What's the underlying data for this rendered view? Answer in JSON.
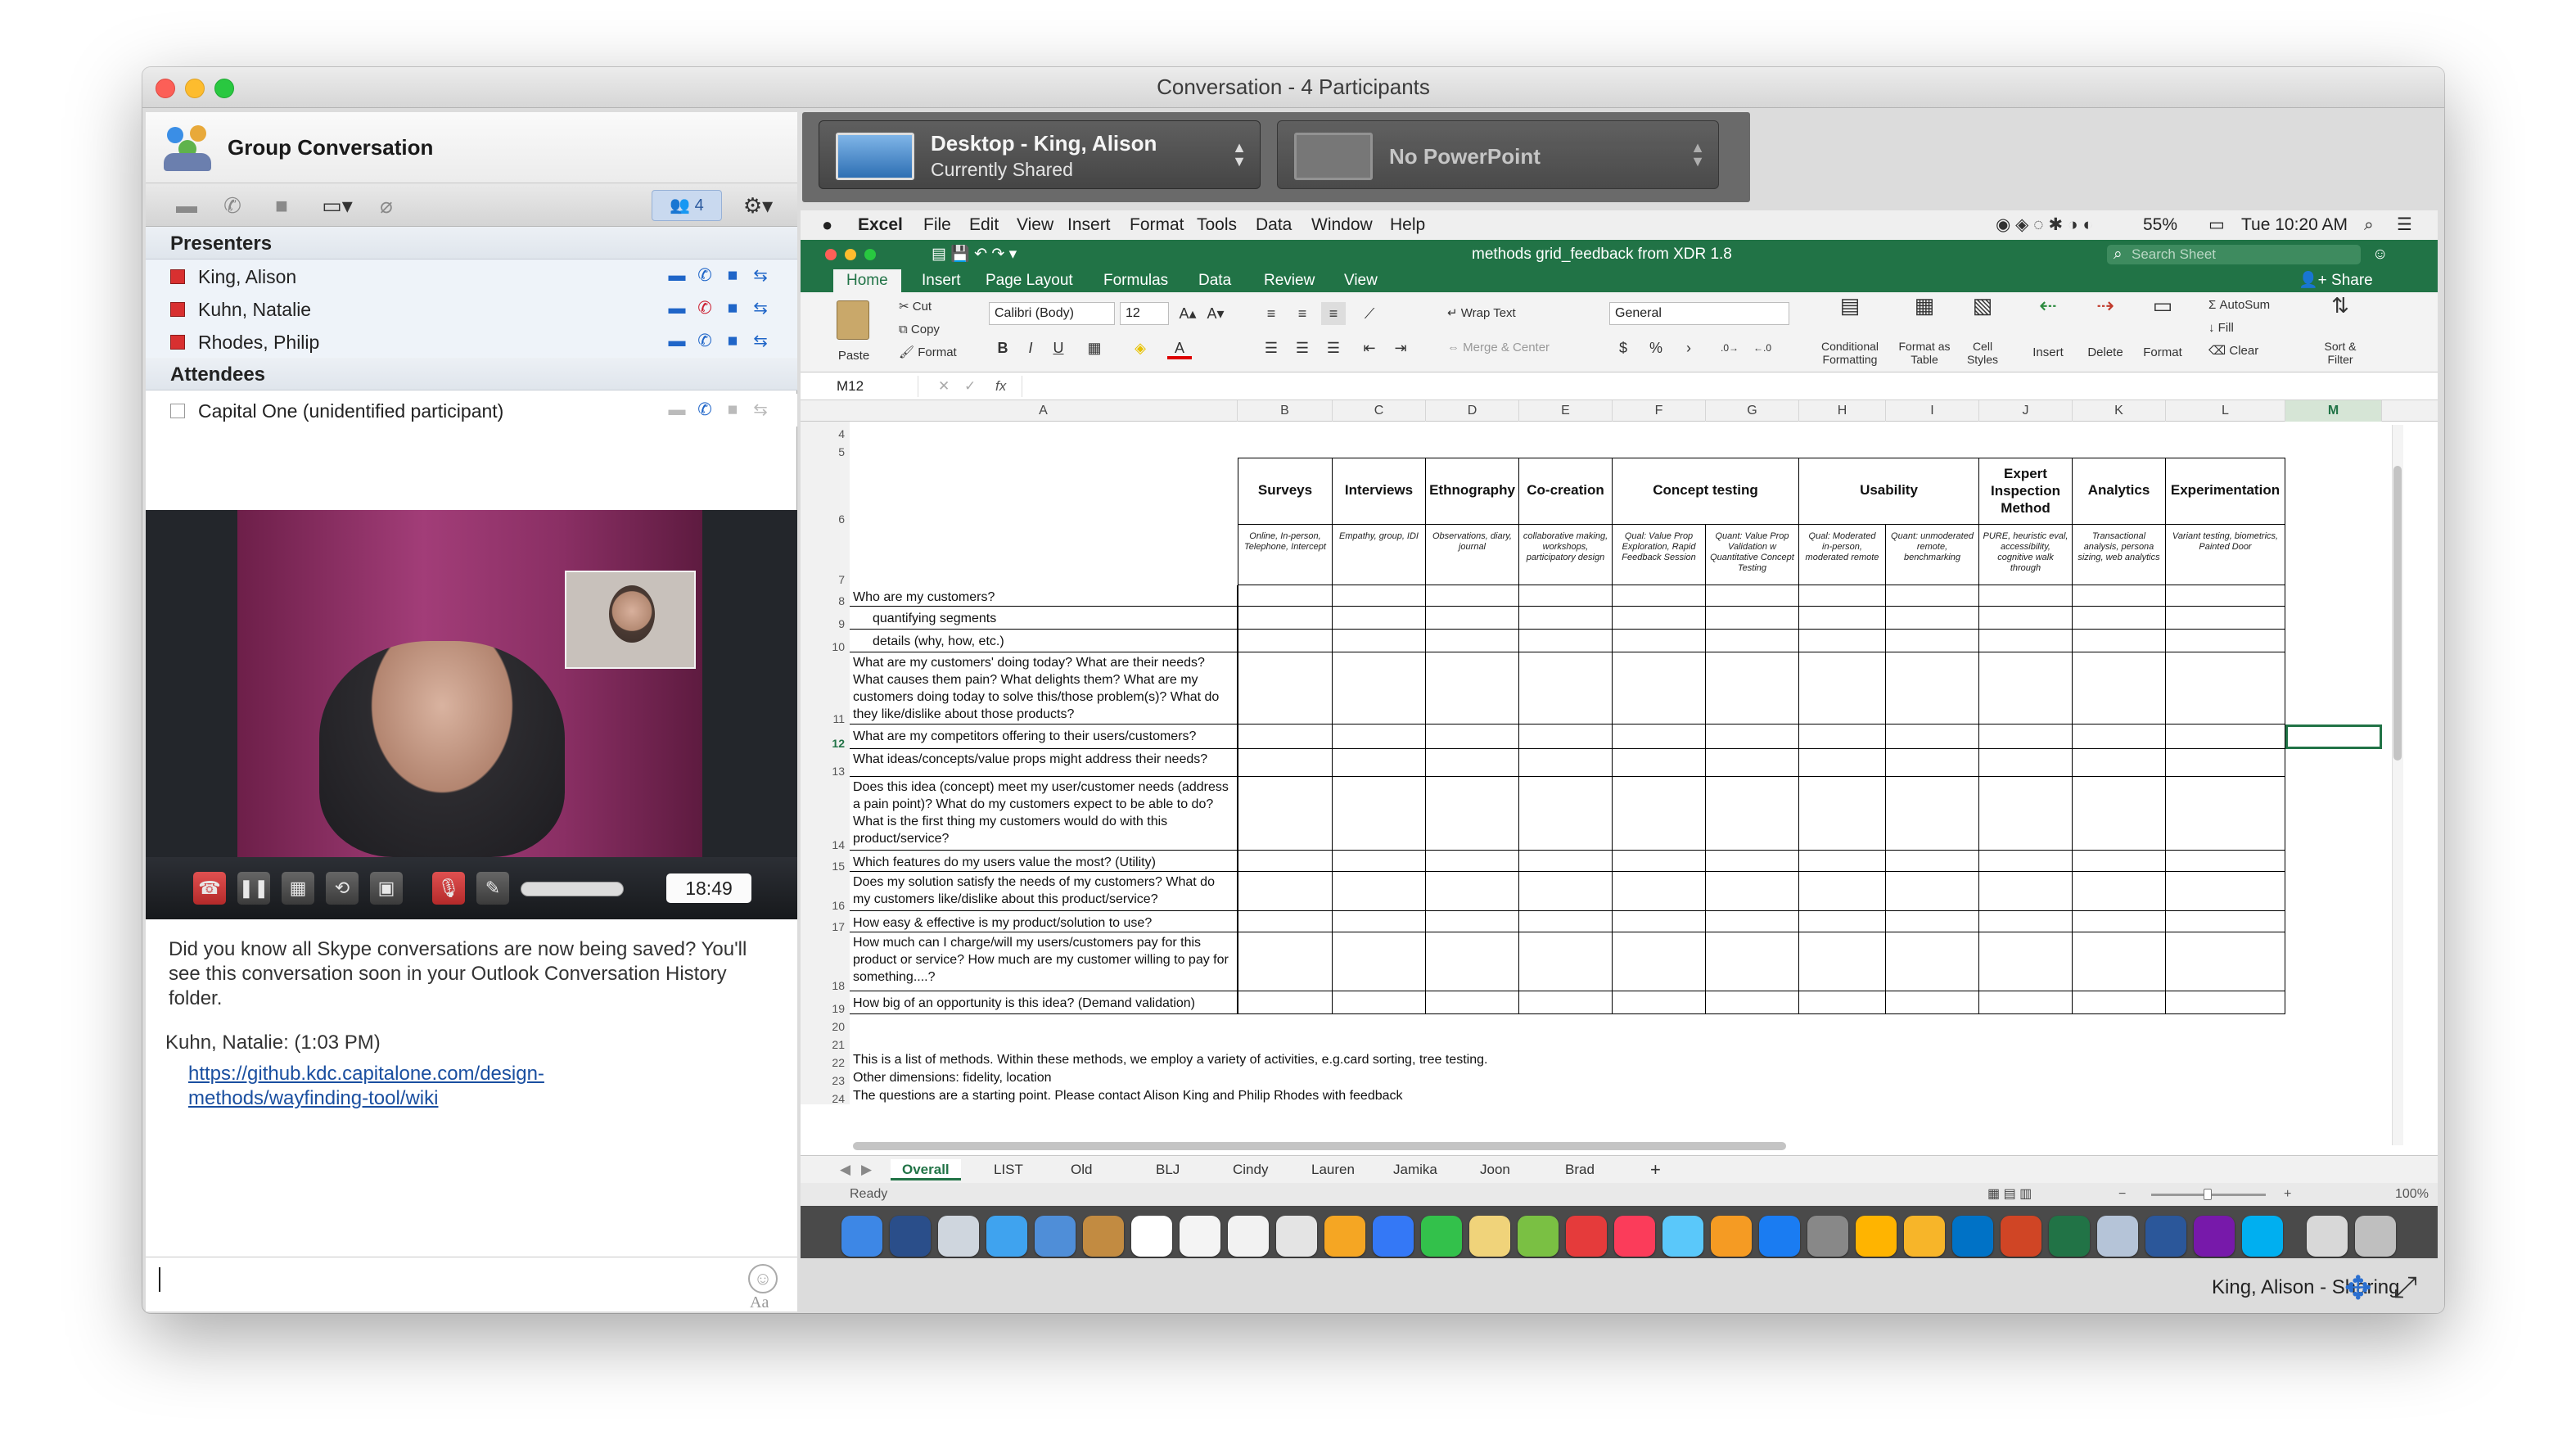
{
  "window": {
    "title": "Conversation - 4 Participants"
  },
  "left": {
    "group_title": "Group Conversation",
    "participant_count": "4",
    "presenters_label": "Presenters",
    "presenters": [
      "King, Alison",
      "Kuhn, Natalie",
      "Rhodes, Philip"
    ],
    "attendees_label": "Attendees",
    "attendees": [
      "Capital One (unidentified participant)"
    ],
    "call_time": "18:49",
    "chat": {
      "notice": "Did you know all Skype conversations are now being saved? You'll see this conversation soon in your Outlook Conversation History folder.",
      "sender": "Kuhn, Natalie: (1:03 PM)",
      "link_line1": "https://github.kdc.capitalone.com/design-",
      "link_line2": "methods/wayfinding-tool/wiki"
    },
    "compose_font_label": "Aa"
  },
  "share": {
    "desktop_title": "Desktop - King, Alison",
    "desktop_sub": "Currently Shared",
    "ppt_title": "No PowerPoint",
    "footer_status": "King, Alison - Sharing"
  },
  "mac_menu": [
    "Excel",
    "File",
    "Edit",
    "View",
    "Insert",
    "Format",
    "Tools",
    "Data",
    "Window",
    "Help"
  ],
  "mac_status": {
    "battery": "55%",
    "clock": "Tue 10:20 AM"
  },
  "excel": {
    "doc_title": "methods grid_feedback from XDR 1.8",
    "search_placeholder": "Search Sheet",
    "share_label": "Share",
    "tabs": [
      "Home",
      "Insert",
      "Page Layout",
      "Formulas",
      "Data",
      "Review",
      "View"
    ],
    "ribbon": {
      "paste": "Paste",
      "cut": "Cut",
      "copy": "Copy",
      "format": "Format",
      "font_name": "Calibri (Body)",
      "font_size": "12",
      "wrap_text": "Wrap Text",
      "merge_center": "Merge & Center",
      "number_format": "General",
      "conditional": "Conditional Formatting",
      "format_table": "Format as Table",
      "cell_styles": "Cell Styles",
      "insert": "Insert",
      "delete": "Delete",
      "format_cells": "Format",
      "autosum": "AutoSum",
      "fill": "Fill",
      "clear": "Clear",
      "sort_filter": "Sort & Filter"
    },
    "name_box": "M12",
    "formula_fx": "fx",
    "columns": [
      "A",
      "B",
      "C",
      "D",
      "E",
      "F",
      "G",
      "H",
      "I",
      "J",
      "K",
      "L",
      "M"
    ],
    "headers": [
      "Surveys",
      "Interviews",
      "Ethnography",
      "Co-creation",
      "Concept testing",
      "Usability",
      "Expert Inspection Method",
      "Analytics",
      "Experimentation"
    ],
    "subheaders": [
      "Online, In-person, Telephone, Intercept",
      "Empathy, group, IDI",
      "Observations, diary, journal",
      "collaborative making, workshops, participatory design",
      "Qual: Value Prop Exploration, Rapid Feedback Session",
      "Quant: Value Prop Validation w Quantitative Concept Testing",
      "Qual: Moderated in-person, moderated remote",
      "Quant: unmoderated remote, benchmarking",
      "PURE, heuristic eval, accessibility, cognitive walk through",
      "Transactional analysis, persona sizing, web analytics",
      "Variant testing, biometrics, Painted Door"
    ],
    "row_numbers": [
      "4",
      "5",
      "6",
      "7",
      "8",
      "9",
      "10",
      "11",
      "12",
      "13",
      "14",
      "15",
      "16",
      "17",
      "18",
      "19",
      "20",
      "21",
      "22",
      "23",
      "24"
    ],
    "questions": [
      "Who are my customers?",
      "quantifying segments",
      "details (why, how, etc.)",
      "What are my customers' doing today? What are their needs? What causes them pain? What delights them? What are my customers doing today to solve this/those problem(s)? What do they like/dislike about those products?",
      "What are my competitors offering to their users/customers?",
      "What ideas/concepts/value props might address their needs?",
      "Does this idea (concept) meet my user/customer needs (address a pain point)? What do my customers expect to be able to do? What is the first thing my customers would do with this product/service?",
      "Which features do my users value the most? (Utility)",
      "Does my solution satisfy the needs of my customers? What do my customers like/dislike about this product/service?",
      "How easy & effective is my product/solution to use?",
      "How much can I charge/will my users/customers pay for this product or service? How much are my customer willing to pay for something....?",
      "How big of an opportunity is this idea? (Demand validation)"
    ],
    "notes": [
      "This is a list of methods. Within these methods, we employ a variety of activities, e.g.card sorting, tree testing.",
      "Other dimensions: fidelity, location",
      "The questions are a starting point. Please contact Alison King and Philip Rhodes with feedback"
    ],
    "sheet_tabs": [
      "Overall",
      "LIST",
      "Old",
      "BLJ",
      "Cindy",
      "Lauren",
      "Jamika",
      "Joon",
      "Brad"
    ],
    "status": "Ready",
    "zoom": "100%"
  },
  "colors": {
    "excel_green": "#217346",
    "skype_blue": "#1f65c8",
    "hangup_red": "#d23b3b"
  }
}
